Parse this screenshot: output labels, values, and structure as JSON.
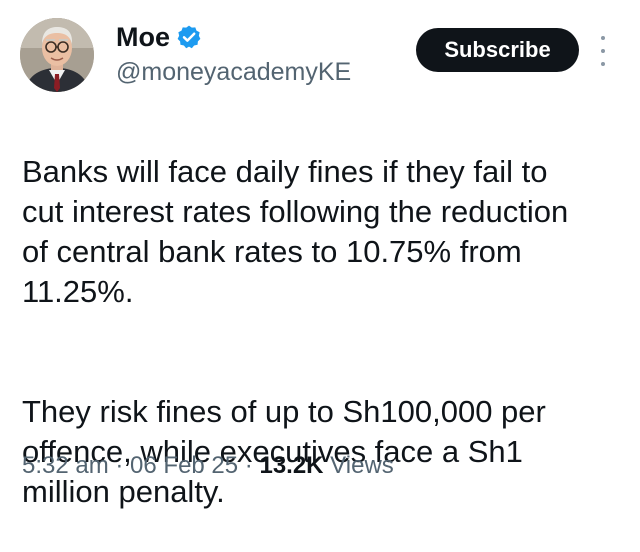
{
  "author": {
    "display_name": "Moe",
    "handle": "@moneyacademyKE",
    "verified": true,
    "avatar_icon": "profile-photo"
  },
  "actions": {
    "subscribe_label": "Subscribe",
    "more_icon": "vertical-ellipsis-icon"
  },
  "tweet": {
    "paragraphs": [
      "Banks will face daily fines if they fail to\ncut interest rates following the reduction\nof central bank rates to 10.75% from\n11.25%.",
      "They risk fines of up to Sh100,000 per\noffence, while executives face a Sh1\nmillion penalty."
    ]
  },
  "meta": {
    "time": "5:32 am",
    "separator": " · ",
    "date": "06 Feb 25",
    "views_count": "13.2K",
    "views_label": " Views"
  },
  "colors": {
    "verified_blue": "#1d9bf0",
    "button_bg": "#0f1419",
    "muted_text": "#536471"
  }
}
